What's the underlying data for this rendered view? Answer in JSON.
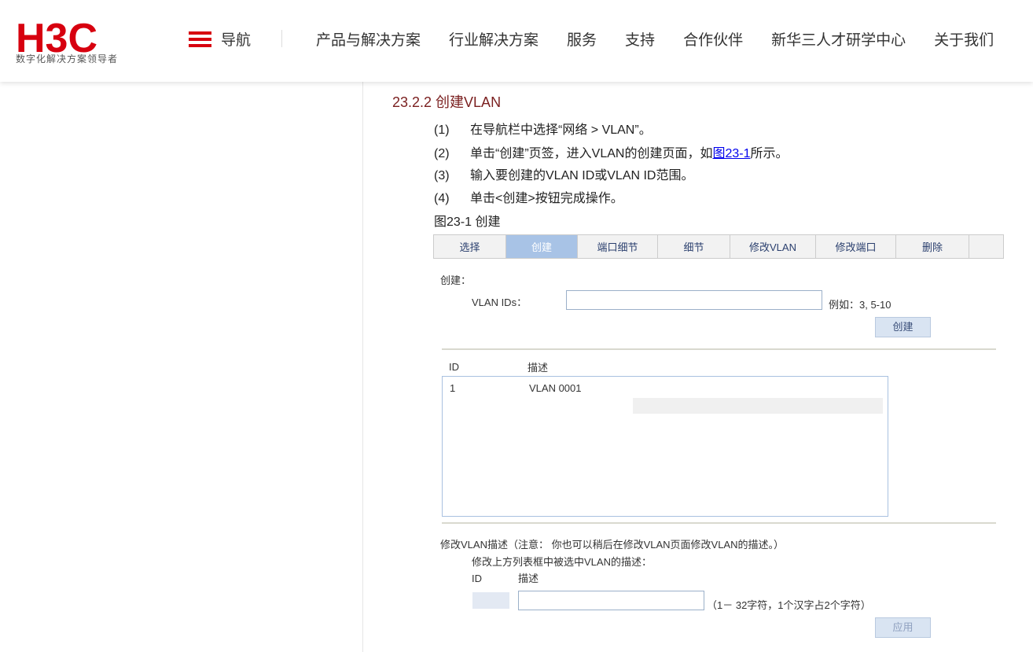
{
  "header": {
    "logo_text": "H3C",
    "tagline": "数字化解决方案领导者",
    "nav_toggle_label": "导航",
    "menu": [
      "产品与解决方案",
      "行业解决方案",
      "服务",
      "支持",
      "合作伙伴",
      "新华三人才研学中心",
      "关于我们"
    ],
    "brand_color": "#d7000f"
  },
  "content": {
    "section_title": "23.2.2  创建VLAN",
    "steps": [
      {
        "num": "(1)",
        "text": "在导航栏中选择“网络 > VLAN”。"
      },
      {
        "num": "(2)",
        "text_before": "单击“创建”页签，进入VLAN的创建页面，如",
        "link": "图23-1",
        "text_after": "所示。"
      },
      {
        "num": "(3)",
        "text": "输入要创建的VLAN ID或VLAN ID范围。"
      },
      {
        "num": "(4)",
        "text": "单击<创建>按钮完成操作。"
      }
    ],
    "figure_caption": "图23-1 创建"
  },
  "figure": {
    "tabs": [
      "选择",
      "创建",
      "端口细节",
      "细节",
      "修改VLAN",
      "修改端口",
      "删除"
    ],
    "active_tab": "创建",
    "create_label": "创建：",
    "vlan_ids_label": "VLAN IDs：",
    "vlan_ids_value": "",
    "example_text": "例如：3, 5-10",
    "create_button": "创建",
    "list_header_id": "ID",
    "list_header_desc": "描述",
    "rows": [
      {
        "id": "1",
        "desc": "VLAN 0001"
      }
    ],
    "modify_title": "修改VLAN描述（注意： 你也可以稍后在修改VLAN页面修改VLAN的描述。）",
    "modify_sub": "修改上方列表框中被选中VLAN的描述：",
    "modify_id_label": "ID",
    "modify_desc_label": "描述",
    "modify_id_value": "",
    "modify_desc_value": "",
    "char_hint": "（1－ 32字符，1个汉字占2个字符）",
    "apply_button": "应用"
  }
}
